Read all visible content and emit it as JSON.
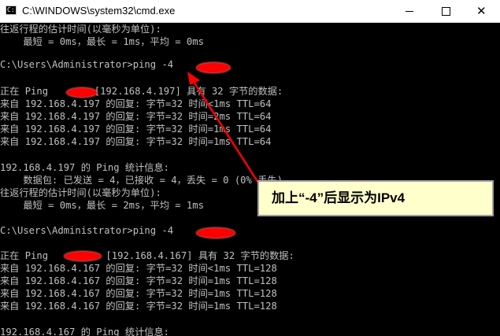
{
  "window": {
    "title": "C:\\WINDOWS\\system32\\cmd.exe",
    "minimize_label": "—",
    "maximize_label": "☐",
    "close_label": "✕"
  },
  "console": {
    "lines": [
      "往返行程的估计时间(以毫秒为单位):",
      "    最短 = 0ms，最长 = 1ms，平均 = 0ms",
      "",
      "C:\\Users\\Administrator>ping -4 ",
      "",
      "正在 Ping        [192.168.4.197] 具有 32 字节的数据:",
      "来自 192.168.4.197 的回复: 字节=32 时间<1ms TTL=64",
      "来自 192.168.4.197 的回复: 字节=32 时间=2ms TTL=64",
      "来自 192.168.4.197 的回复: 字节=32 时间=1ms TTL=64",
      "来自 192.168.4.197 的回复: 字节=32 时间=1ms TTL=64",
      "",
      "192.168.4.197 的 Ping 统计信息:",
      "    数据包: 已发送 = 4，已接收 = 4，丢失 = 0 (0% 丢失)，",
      "往返行程的估计时间(以毫秒为单位):",
      "    最短 = 0ms，最长 = 2ms，平均 = 1ms",
      "",
      "C:\\Users\\Administrator>ping -4 ",
      "",
      "正在 Ping          [192.168.4.167] 具有 32 字节的数据:",
      "来自 192.168.4.167 的回复: 字节=32 时间<1ms TTL=128",
      "来自 192.168.4.167 的回复: 字节=32 时间=1ms TTL=128",
      "来自 192.168.4.167 的回复: 字节=32 时间=1ms TTL=128",
      "来自 192.168.4.167 的回复: 字节=32 时间=1ms TTL=128",
      "",
      "192.168.4.167 的 Ping 统计信息:"
    ]
  },
  "annotation": {
    "text": "加上“-4”后显示为IPv4"
  },
  "colors": {
    "console_bg": "#000000",
    "console_text": "#c0c0c0",
    "redaction": "#ff0000",
    "arrow": "#ff0000",
    "annotation_bg": "#ffffcc"
  },
  "icons": {
    "app": "cmd-icon",
    "minimize": "minimize-icon",
    "maximize": "maximize-icon",
    "close": "close-icon"
  }
}
